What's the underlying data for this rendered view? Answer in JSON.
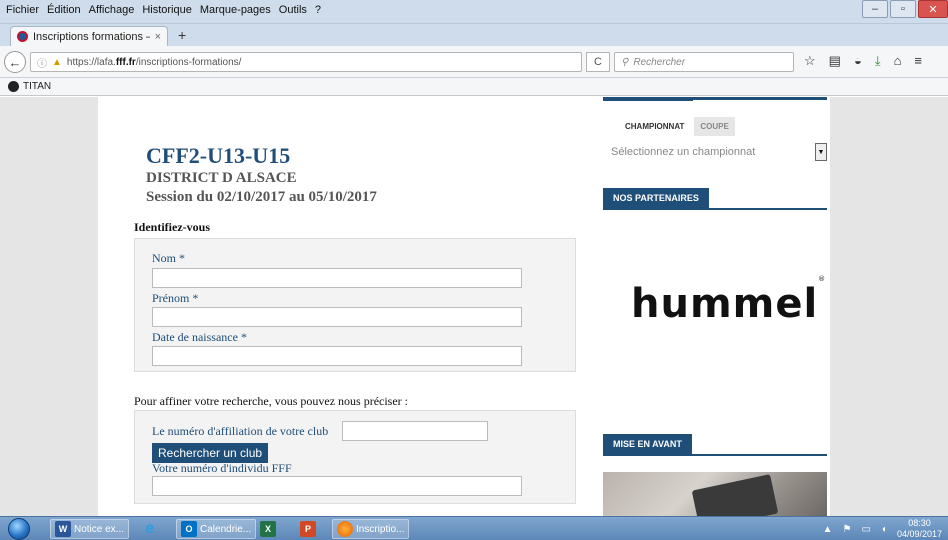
{
  "window": {
    "menu": [
      "Fichier",
      "Édition",
      "Affichage",
      "Historique",
      "Marque-pages",
      "Outils",
      "?"
    ],
    "tab_title": "Inscriptions formations – D…",
    "tab_close": "×",
    "new_tab": "+"
  },
  "nav": {
    "url_prefix": "https://lafa.",
    "url_domain": "fff.fr",
    "url_path": "/inscriptions-formations/",
    "search_placeholder": "Rechercher",
    "icons": [
      "star-icon",
      "reading-list-icon",
      "pocket-icon",
      "download-icon",
      "home-icon",
      "menu-icon"
    ]
  },
  "bookmarks": {
    "items": [
      "TITAN"
    ]
  },
  "form": {
    "title": "CFF2-U13-U15",
    "district": "DISTRICT D ALSACE",
    "session": "Session du 02/10/2017 au 05/10/2017",
    "identify_heading": "Identifiez-vous",
    "fields": {
      "nom": "Nom *",
      "prenom": "Prénom *",
      "naissance": "Date de naissance *"
    },
    "refine_text": "Pour affiner votre recherche, vous pouvez nous préciser :",
    "affiliation_label": "Le numéro d'affiliation de votre club",
    "club_button": "Rechercher un club",
    "individu_label": "Votre numéro d'individu FFF"
  },
  "sidebar": {
    "tabs": [
      "CHAMPIONNAT",
      "COUPE"
    ],
    "select_placeholder": "Sélectionnez un championnat",
    "partners_heading": "NOS PARTENAIRES",
    "partner_logo": "hummel",
    "partner_logo_mark": "®",
    "highlight_heading": "MISE EN AVANT"
  },
  "taskbar": {
    "items": [
      {
        "label": "Notice ex...",
        "icon": "word-icon"
      },
      {
        "label": "",
        "icon": "ie-icon"
      },
      {
        "label": "Calendrie...",
        "icon": "outlook-icon"
      },
      {
        "label": "",
        "icon": "excel-icon"
      },
      {
        "label": "",
        "icon": "powerpoint-icon"
      },
      {
        "label": "Inscriptio...",
        "icon": "firefox-icon"
      }
    ],
    "time": "08:30",
    "date": "04/09/2017"
  },
  "colors": {
    "brand_blue": "#1f4e79",
    "taskbar": "#5c87b7"
  }
}
